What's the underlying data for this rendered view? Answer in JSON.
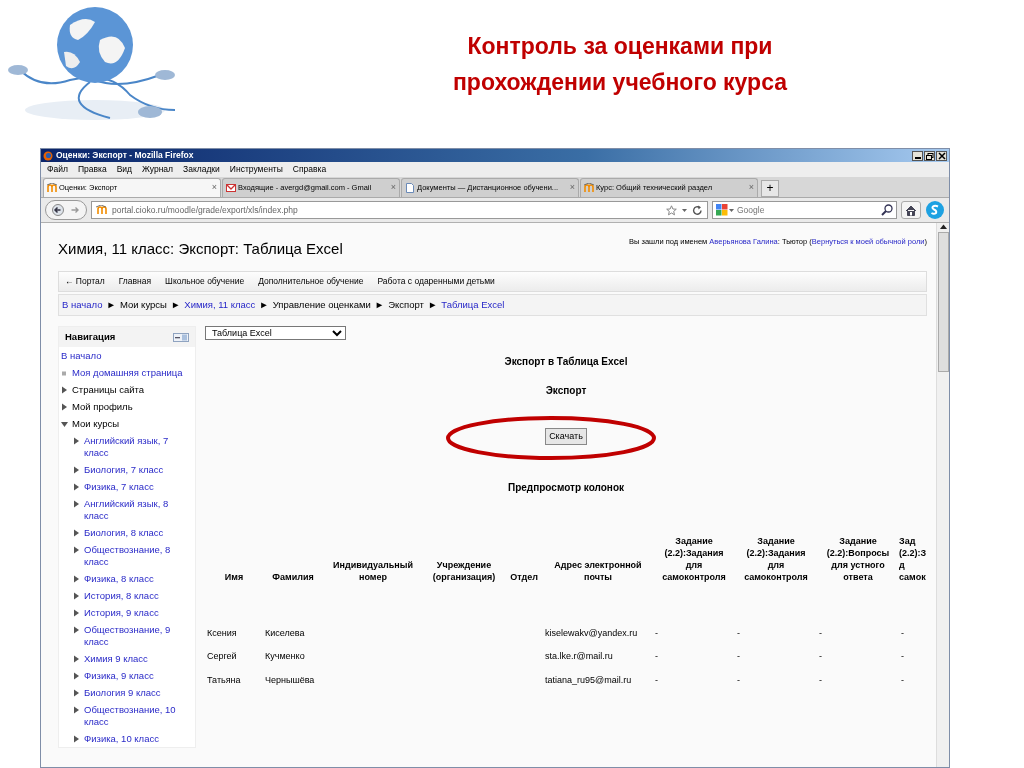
{
  "slide": {
    "title": "Контроль за оценками при прохождении учебного курса"
  },
  "window": {
    "title": "Оценки: Экспорт - Mozilla Firefox"
  },
  "menu": [
    "Файл",
    "Правка",
    "Вид",
    "Журнал",
    "Закладки",
    "Инструменты",
    "Справка"
  ],
  "tabs": [
    {
      "label": "Оценки: Экспорт",
      "kind": "moodle",
      "selected": true,
      "close": "×"
    },
    {
      "label": "Входящие - avergd@gmail.com - Gmail",
      "kind": "mail",
      "selected": false,
      "close": "×"
    },
    {
      "label": "Документы — Дистанционное обучени...",
      "kind": "document",
      "selected": false,
      "close": "×"
    },
    {
      "label": "Курс: Общий технический раздел",
      "kind": "moodle",
      "selected": false,
      "close": "×"
    }
  ],
  "new_tab": "+",
  "address": {
    "url": "portal.cioko.ru/moodle/grade/export/xls/index.php",
    "search_placeholder": "Google"
  },
  "page": {
    "title": "Химия, 11 класс: Экспорт: Таблица Excel",
    "login": {
      "prefix": "Вы зашли под именем",
      "user": "Аверьянова Галина",
      "role": ": Тьютор (",
      "link": "Вернуться к моей обычной роли",
      "suffix": ")"
    },
    "topmenu": [
      "← Портал",
      "Главная",
      "Школьное обучение",
      "Дополнительное обучение",
      "Работа с одаренными детьми"
    ],
    "breadcrumb": {
      "separator": "►",
      "items": [
        {
          "label": "В начало",
          "link": true
        },
        {
          "label": "Мои курсы",
          "link": false
        },
        {
          "label": "Химия, 11 класс",
          "link": true
        },
        {
          "label": "Управление оценками",
          "link": false
        },
        {
          "label": "Экспорт",
          "link": false
        },
        {
          "label": "Таблица Excel",
          "link": true
        }
      ]
    }
  },
  "navigation": {
    "title": "Навигация",
    "items": [
      {
        "label": "В начало",
        "kind": "link"
      },
      {
        "label": "Моя домашняя страница",
        "kind": "leaf"
      },
      {
        "label": "Страницы сайта",
        "kind": "branch",
        "expanded": false
      },
      {
        "label": "Мой профиль",
        "kind": "branch",
        "expanded": false
      },
      {
        "label": "Мои курсы",
        "kind": "branch",
        "expanded": true,
        "children": [
          {
            "label": "Английский язык, 7 класс",
            "kind": "course",
            "expanded": false
          },
          {
            "label": "Биология, 7 класс",
            "kind": "course",
            "expanded": false
          },
          {
            "label": "Физика, 7 класс",
            "kind": "course",
            "expanded": false
          },
          {
            "label": "Английский язык, 8 класс",
            "kind": "course",
            "expanded": false
          },
          {
            "label": "Биология, 8 класс",
            "kind": "course",
            "expanded": false
          },
          {
            "label": "Обществознание, 8 класс",
            "kind": "course",
            "expanded": false
          },
          {
            "label": "Физика, 8 класс",
            "kind": "course",
            "expanded": false
          },
          {
            "label": "История, 8 класс",
            "kind": "course",
            "expanded": false
          },
          {
            "label": "История, 9 класс",
            "kind": "course",
            "expanded": false
          },
          {
            "label": "Обществознание, 9 класс",
            "kind": "course",
            "expanded": false
          },
          {
            "label": "Химия 9 класс",
            "kind": "course",
            "expanded": false
          },
          {
            "label": "Физика, 9 класс",
            "kind": "course",
            "expanded": false
          },
          {
            "label": "Биология 9 класс",
            "kind": "course",
            "expanded": false
          },
          {
            "label": "Обществознание, 10 класс",
            "kind": "course",
            "expanded": false
          },
          {
            "label": "Физика, 10 класс",
            "kind": "course",
            "expanded": false
          }
        ]
      }
    ]
  },
  "export": {
    "format": "Таблица Excel",
    "heading": "Экспорт в Таблица Excel",
    "subheading": "Экспорт",
    "download": {
      "label": "Скачать",
      "circled": true
    },
    "preview_heading": "Предпросмотр колонок"
  },
  "table": {
    "columns": [
      "Имя",
      "Фамилия",
      "Индивидуальный номер",
      "Учреждение (организация)",
      "Отдел",
      "Адрес электронной почты",
      "Задание (2.2):Задания для самоконтроля",
      "Задание (2.2):Задания для самоконтроля",
      "Задание (2.2):Вопросы для устного ответа",
      "Зад\n(2.2):З\nд\nсамок"
    ],
    "rows": [
      [
        "Ксения",
        "Киселева",
        "",
        "",
        "",
        "kiselewakv@yandex.ru",
        "-",
        "-",
        "-",
        "-"
      ],
      [
        "Сергей",
        "Кучменко",
        "",
        "",
        "",
        "sta.lke.r@mail.ru",
        "-",
        "-",
        "-",
        "-"
      ],
      [
        "Татьяна",
        "Чернышёва",
        "",
        "",
        "",
        "tatiana_ru95@mail.ru",
        "-",
        "-",
        "-",
        "-"
      ]
    ]
  }
}
